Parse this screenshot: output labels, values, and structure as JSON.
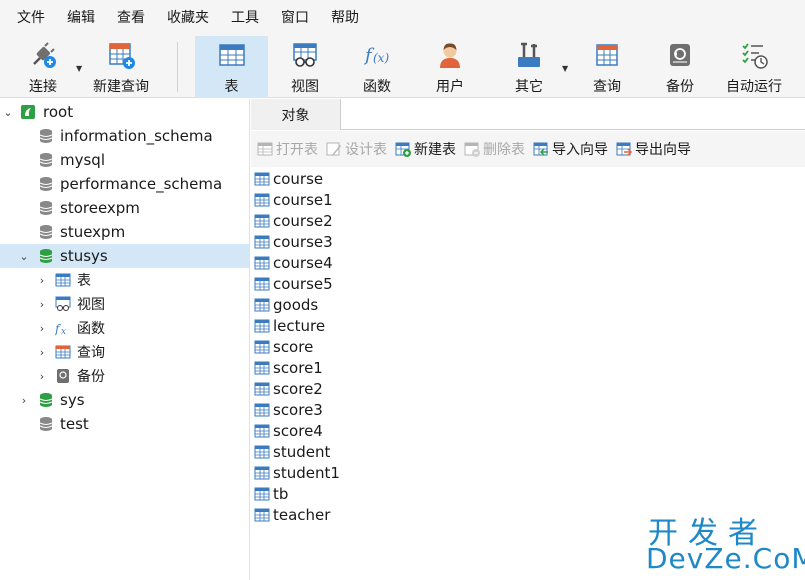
{
  "menu": [
    "文件",
    "编辑",
    "查看",
    "收藏夹",
    "工具",
    "窗口",
    "帮助"
  ],
  "toolbar": {
    "connect": "连接",
    "new_query": "新建查询",
    "table": "表",
    "view": "视图",
    "function": "函数",
    "user": "用户",
    "other": "其它",
    "query": "查询",
    "backup": "备份",
    "autorun": "自动运行"
  },
  "tree": {
    "root": "root",
    "databases": [
      "information_schema",
      "mysql",
      "performance_schema",
      "storeexpm",
      "stuexpm",
      "stusys",
      "sys",
      "test"
    ],
    "stusys_children": [
      "表",
      "视图",
      "函数",
      "查询",
      "备份"
    ]
  },
  "tab": {
    "label": "对象"
  },
  "actions": {
    "open_table": "打开表",
    "design_table": "设计表",
    "new_table": "新建表",
    "delete_table": "删除表",
    "import_wizard": "导入向导",
    "export_wizard": "导出向导"
  },
  "tables": [
    "course",
    "course1",
    "course2",
    "course3",
    "course4",
    "course5",
    "goods",
    "lecture",
    "score",
    "score1",
    "score2",
    "score3",
    "score4",
    "student",
    "student1",
    "tb",
    "teacher"
  ],
  "watermark": {
    "line1": "开发者",
    "line2": "DevZe.CoM"
  },
  "colors": {
    "selection": "#d4e7f7",
    "db_green": "#2ea043",
    "table_blue": "#3b7bc0",
    "watermark": "#1e88c8"
  }
}
